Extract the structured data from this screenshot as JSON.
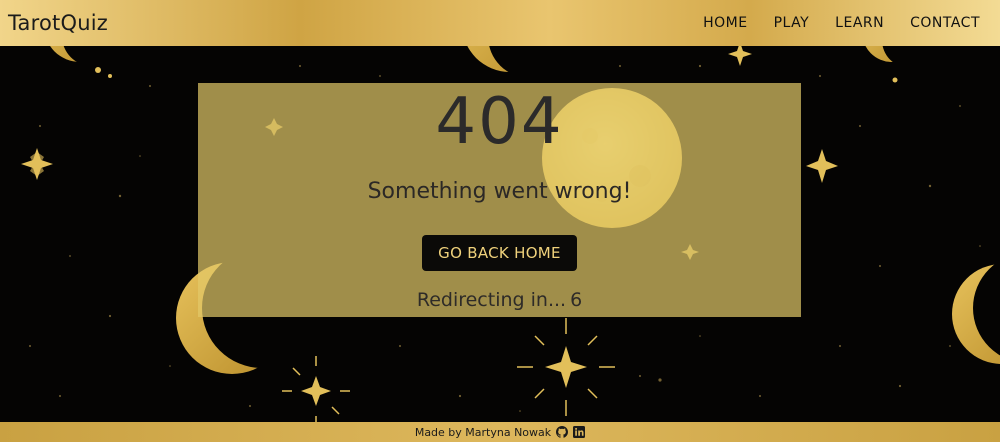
{
  "header": {
    "brand": "TarotQuiz",
    "nav": [
      {
        "label": "HOME"
      },
      {
        "label": "PLAY"
      },
      {
        "label": "LEARN"
      },
      {
        "label": "CONTACT"
      }
    ]
  },
  "error": {
    "code": "404",
    "message": "Something went wrong!",
    "button_label": "GO BACK HOME",
    "redirect_text": "Redirecting in...",
    "redirect_count": "6"
  },
  "footer": {
    "credit": "Made by Martyna Nowak",
    "icons": [
      "github-icon",
      "linkedin-icon"
    ]
  },
  "colors": {
    "gold": "#e2c96a",
    "dark": "#050403",
    "button_text": "#f0d27c"
  }
}
